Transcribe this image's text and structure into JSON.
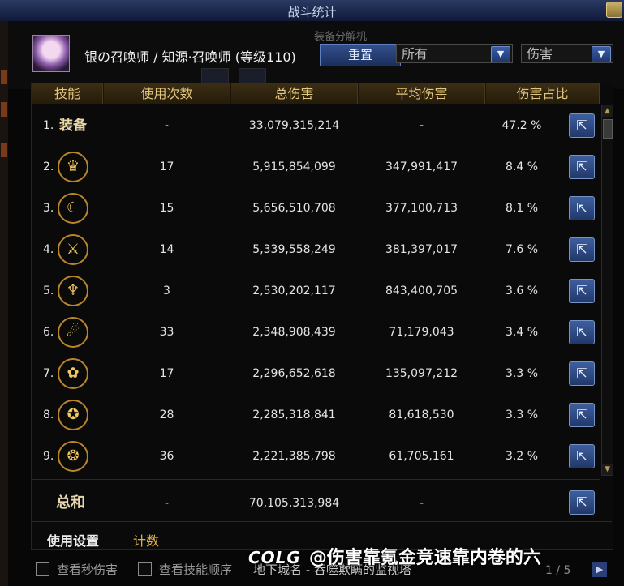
{
  "window": {
    "title": "战斗统计"
  },
  "header": {
    "character": "银の召唤师 / 知源·召唤师 (等级110)",
    "reset_label": "重置",
    "filter1": "所有",
    "filter2": "伤害",
    "bg_text1": "装备分解机"
  },
  "columns": [
    "技能",
    "使用次数",
    "总伤害",
    "平均伤害",
    "伤害占比"
  ],
  "rows": [
    {
      "rank": "1.",
      "skill": "装备",
      "uses": "-",
      "total": "33,079,315,214",
      "avg": "-",
      "pct": "47.2 %"
    },
    {
      "rank": "2.",
      "skill_icon": "crown-icon",
      "uses": "17",
      "total": "5,915,854,099",
      "avg": "347,991,417",
      "pct": "8.4 %"
    },
    {
      "rank": "3.",
      "skill_icon": "moon-icon",
      "uses": "15",
      "total": "5,656,510,708",
      "avg": "377,100,713",
      "pct": "8.1 %"
    },
    {
      "rank": "4.",
      "skill_icon": "blade-icon",
      "uses": "14",
      "total": "5,339,558,249",
      "avg": "381,397,017",
      "pct": "7.6 %"
    },
    {
      "rank": "5.",
      "skill_icon": "demon-icon",
      "uses": "3",
      "total": "2,530,202,117",
      "avg": "843,400,705",
      "pct": "3.6 %"
    },
    {
      "rank": "6.",
      "skill_icon": "dragon-icon",
      "uses": "33",
      "total": "2,348,908,439",
      "avg": "71,179,043",
      "pct": "3.4 %"
    },
    {
      "rank": "7.",
      "skill_icon": "flower-icon",
      "uses": "17",
      "total": "2,296,652,618",
      "avg": "135,097,212",
      "pct": "3.3 %"
    },
    {
      "rank": "8.",
      "skill_icon": "rune-icon",
      "uses": "28",
      "total": "2,285,318,841",
      "avg": "81,618,530",
      "pct": "3.3 %"
    },
    {
      "rank": "9.",
      "skill_icon": "beast-icon",
      "uses": "36",
      "total": "2,221,385,798",
      "avg": "61,705,161",
      "pct": "3.2 %"
    }
  ],
  "total": {
    "label": "总和",
    "uses": "-",
    "total": "70,105,313,984",
    "avg": "-"
  },
  "tabs": {
    "settings": "使用设置",
    "count": "计数"
  },
  "bottom": {
    "check1": "查看秒伤害",
    "check2": "查看技能顺序",
    "dungeon": "地下城名 - 吞噬欺瞒的监视塔",
    "page": "1 / 5"
  },
  "watermark": {
    "logo": "COLG",
    "text": "@伤害靠氪金竞速靠内卷的六"
  },
  "colors": {
    "accent": "#e2c87e",
    "button_blue": "#33508c"
  }
}
